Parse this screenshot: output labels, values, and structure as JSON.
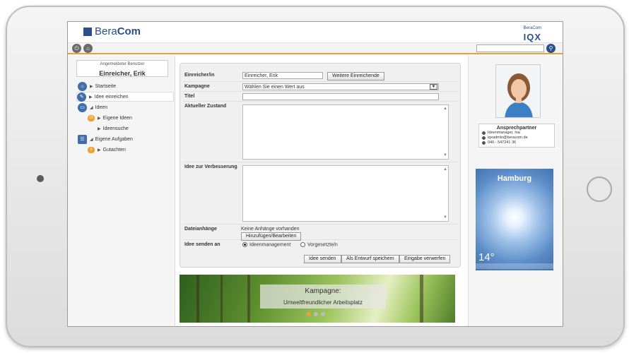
{
  "app": {
    "brand_first": "Bera",
    "brand_second": "Com",
    "iqx_small": "BeraCom",
    "iqx_big": "IQX"
  },
  "toolbar": {
    "power_icon": "power-icon",
    "home_icon": "home-icon",
    "search_placeholder": "",
    "search_icon": "search-icon"
  },
  "user": {
    "caption": "Angemeldeter Benutzer",
    "name": "Einreicher, Erik"
  },
  "nav": {
    "items": [
      {
        "label": "Startseite"
      },
      {
        "label": "Idee einreichen"
      },
      {
        "label": "Ideen"
      },
      {
        "label": "Eigene Ideen",
        "badge": "18"
      },
      {
        "label": "Ideensuche"
      },
      {
        "label": "Eigene Aufgaben",
        "badge": "8"
      },
      {
        "label": "Gutachten",
        "badge": "0"
      }
    ]
  },
  "form": {
    "submitter_label": "Einreicher/in",
    "submitter_value": "Einreicher, Erik",
    "more_submitters_button": "Weitere Einreichende",
    "campaign_label": "Kampagne",
    "campaign_value": "Wählen Sie einen Wert aus",
    "title_label": "Titel",
    "title_value": "",
    "current_state_label": "Aktueller Zustand",
    "improvement_label": "Idee zur Verbesserung",
    "attachments_label": "Dateianhänge",
    "attachments_none": "Keine Anhänge vorhanden",
    "attachments_button": "Hinzufügen/Bearbeiten",
    "send_to_label": "Idee senden an",
    "send_to_options": [
      "Ideenmanagement",
      "Vorgesetzte/n"
    ],
    "send_button": "Idee senden",
    "draft_button": "Als Entwurf speichern",
    "discard_button": "Eingabe verwerfen"
  },
  "banner": {
    "title": "Kampagne:",
    "subtitle": "Umweltfreundlicher Arbeitsplatz"
  },
  "contact": {
    "heading": "Ansprechpartner",
    "name": "Ideenmanager, Ina",
    "email": "iqxadmin@beracom.de",
    "phone": "040 - 547241 36"
  },
  "weather": {
    "city": "Hamburg",
    "temperature": "14°"
  },
  "colors": {
    "accent": "#f0a030",
    "brand": "#2b4f8a"
  }
}
